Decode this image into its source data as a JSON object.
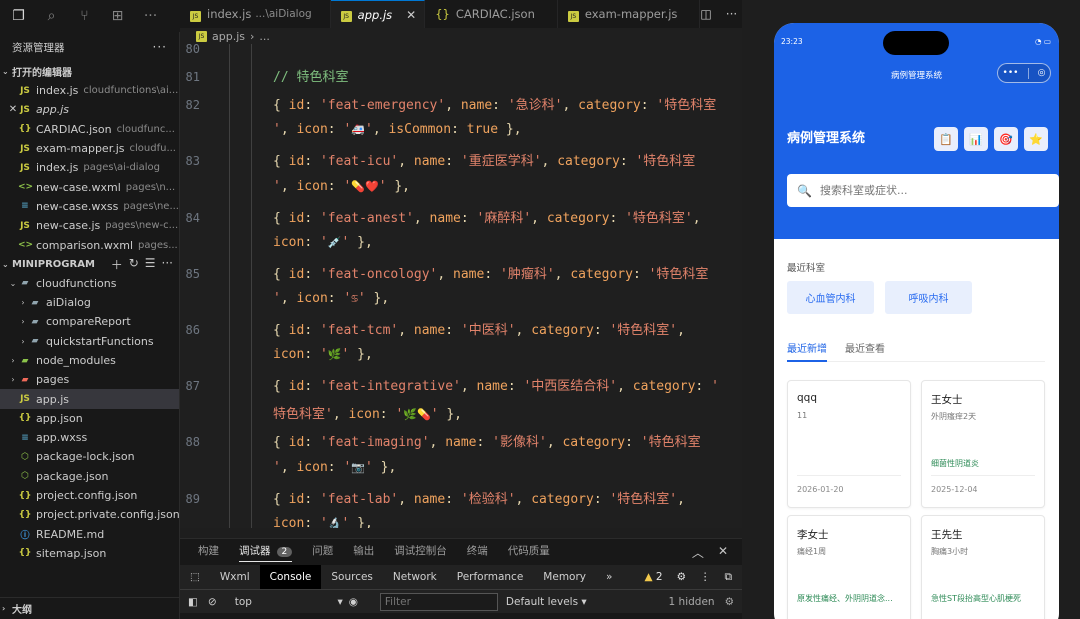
{
  "sidebar": {
    "title": "资源管理器",
    "more": "···",
    "open_editors_label": "打开的编辑器",
    "open_editors": [
      {
        "name": "index.js",
        "desc": "cloudfunctions\\ai...",
        "icon": "JS",
        "italic": false,
        "close": ""
      },
      {
        "name": "app.js",
        "desc": "",
        "icon": "JS",
        "italic": true,
        "close": "✕"
      },
      {
        "name": "CARDIAC.json",
        "desc": "cloudfunc...",
        "icon": "{}",
        "italic": false,
        "close": ""
      },
      {
        "name": "exam-mapper.js",
        "desc": "cloudfu...",
        "icon": "JS",
        "italic": false,
        "close": ""
      },
      {
        "name": "index.js",
        "desc": "pages\\ai-dialog",
        "icon": "JS",
        "italic": false,
        "close": ""
      },
      {
        "name": "new-case.wxml",
        "desc": "pages\\n...",
        "icon": "<>",
        "italic": false,
        "close": ""
      },
      {
        "name": "new-case.wxss",
        "desc": "pages\\ne...",
        "icon": "≡",
        "italic": false,
        "close": ""
      },
      {
        "name": "new-case.js",
        "desc": "pages\\new-c...",
        "icon": "JS",
        "italic": false,
        "close": ""
      },
      {
        "name": "comparison.wxml",
        "desc": "pages...",
        "icon": "<>",
        "italic": false,
        "close": ""
      }
    ],
    "project_label": "MINIPROGRAM",
    "tree": [
      {
        "name": "cloudfunctions",
        "arrow": "⌄",
        "indent": 1,
        "icon": "folder-open"
      },
      {
        "name": "aiDialog",
        "arrow": "›",
        "indent": 2,
        "icon": "folder"
      },
      {
        "name": "compareReport",
        "arrow": "›",
        "indent": 2,
        "icon": "folder"
      },
      {
        "name": "quickstartFunctions",
        "arrow": "›",
        "indent": 2,
        "icon": "folder"
      },
      {
        "name": "node_modules",
        "arrow": "›",
        "indent": 1,
        "icon": "folder-node"
      },
      {
        "name": "pages",
        "arrow": "›",
        "indent": 1,
        "icon": "folder-pages"
      },
      {
        "name": "app.js",
        "arrow": "",
        "indent": 1,
        "icon": "js",
        "selected": true
      },
      {
        "name": "app.json",
        "arrow": "",
        "indent": 1,
        "icon": "json"
      },
      {
        "name": "app.wxss",
        "arrow": "",
        "indent": 1,
        "icon": "wxss"
      },
      {
        "name": "package-lock.json",
        "arrow": "",
        "indent": 1,
        "icon": "package"
      },
      {
        "name": "package.json",
        "arrow": "",
        "indent": 1,
        "icon": "package"
      },
      {
        "name": "project.config.json",
        "arrow": "",
        "indent": 1,
        "icon": "json"
      },
      {
        "name": "project.private.config.json",
        "arrow": "",
        "indent": 1,
        "icon": "json"
      },
      {
        "name": "README.md",
        "arrow": "",
        "indent": 1,
        "icon": "info"
      },
      {
        "name": "sitemap.json",
        "arrow": "",
        "indent": 1,
        "icon": "json"
      }
    ],
    "outline_label": "大纲"
  },
  "tabs": [
    {
      "name": "index.js",
      "desc": "...\\aiDialog",
      "active": false,
      "close": ""
    },
    {
      "name": "app.js",
      "desc": "",
      "active": true,
      "close": "✕"
    },
    {
      "name": "CARDIAC.json",
      "desc": "",
      "active": false,
      "close": ""
    },
    {
      "name": "exam-mapper.js",
      "desc": "",
      "active": false,
      "close": ""
    }
  ],
  "breadcrumb": {
    "file": "app.js",
    "more": "..."
  },
  "code": {
    "lines": [
      {
        "num": "80",
        "html": ""
      },
      {
        "num": "81",
        "html": "<span class='c'>// 特色科室</span>"
      },
      {
        "num": "82",
        "html": "<span class='p'>{ </span><span class='k'>id</span><span class='p'>: </span><span class='s'>'feat-emergency'</span><span class='p'>, </span><span class='k'>name</span><span class='p'>: </span><span class='s'>'急诊科'</span><span class='p'>, </span><span class='k'>category</span><span class='p'>: </span><span class='s'>'特色科室</span>"
      },
      {
        "num": "",
        "html": "<span class='s'>'</span><span class='p'>, </span><span class='k'>icon</span><span class='p'>: </span><span class='s'>'<span class=\"e\">🚑</span>'</span><span class='p'>, </span><span class='k'>isCommon</span><span class='p'>: </span><span class='b'>true</span><span class='p'> },</span>"
      },
      {
        "num": "83",
        "html": "<span class='p'>{ </span><span class='k'>id</span><span class='p'>: </span><span class='s'>'feat-icu'</span><span class='p'>, </span><span class='k'>name</span><span class='p'>: </span><span class='s'>'重症医学科'</span><span class='p'>, </span><span class='k'>category</span><span class='p'>: </span><span class='s'>'特色科室</span>"
      },
      {
        "num": "",
        "html": "<span class='s'>'</span><span class='p'>, </span><span class='k'>icon</span><span class='p'>: </span><span class='s'>'<span class=\"e\">💊❤️</span>'</span><span class='p'> },</span>"
      },
      {
        "num": "84",
        "html": "<span class='p'>{ </span><span class='k'>id</span><span class='p'>: </span><span class='s'>'feat-anest'</span><span class='p'>, </span><span class='k'>name</span><span class='p'>: </span><span class='s'>'麻醉科'</span><span class='p'>, </span><span class='k'>category</span><span class='p'>: </span><span class='s'>'特色科室'</span><span class='p'>,</span>"
      },
      {
        "num": "",
        "html": "<span class='k'>icon</span><span class='p'>: </span><span class='s'>'<span class=\"e\">💉</span>'</span><span class='p'> },</span>"
      },
      {
        "num": "85",
        "html": "<span class='p'>{ </span><span class='k'>id</span><span class='p'>: </span><span class='s'>'feat-oncology'</span><span class='p'>, </span><span class='k'>name</span><span class='p'>: </span><span class='s'>'肿瘤科'</span><span class='p'>, </span><span class='k'>category</span><span class='p'>: </span><span class='s'>'特色科室</span>"
      },
      {
        "num": "",
        "html": "<span class='s'>'</span><span class='p'>, </span><span class='k'>icon</span><span class='p'>: </span><span class='s'>'<span class=\"e\">♋</span>'</span><span class='p'> },</span>"
      },
      {
        "num": "86",
        "html": "<span class='p'>{ </span><span class='k'>id</span><span class='p'>: </span><span class='s'>'feat-tcm'</span><span class='p'>, </span><span class='k'>name</span><span class='p'>: </span><span class='s'>'中医科'</span><span class='p'>, </span><span class='k'>category</span><span class='p'>: </span><span class='s'>'特色科室'</span><span class='p'>,</span>"
      },
      {
        "num": "",
        "html": "<span class='k'>icon</span><span class='p'>: </span><span class='s'>'<span class=\"e\">🌿</span>'</span><span class='p'> },</span>"
      },
      {
        "num": "87",
        "html": "<span class='p'>{ </span><span class='k'>id</span><span class='p'>: </span><span class='s'>'feat-integrative'</span><span class='p'>, </span><span class='k'>name</span><span class='p'>: </span><span class='s'>'中西医结合科'</span><span class='p'>, </span><span class='k'>category</span><span class='p'>: </span><span class='s'>'</span>"
      },
      {
        "num": "",
        "html": "<span class='s'>特色科室'</span><span class='p'>, </span><span class='k'>icon</span><span class='p'>: </span><span class='s'>'<span class=\"e\">🌿💊</span>'</span><span class='p'> },</span>"
      },
      {
        "num": "88",
        "html": "<span class='p'>{ </span><span class='k'>id</span><span class='p'>: </span><span class='s'>'feat-imaging'</span><span class='p'>, </span><span class='k'>name</span><span class='p'>: </span><span class='s'>'影像科'</span><span class='p'>, </span><span class='k'>category</span><span class='p'>: </span><span class='s'>'特色科室</span>"
      },
      {
        "num": "",
        "html": "<span class='s'>'</span><span class='p'>, </span><span class='k'>icon</span><span class='p'>: </span><span class='s'>'<span class=\"e\">📷</span>'</span><span class='p'> },</span>"
      },
      {
        "num": "89",
        "html": "<span class='p'>{ </span><span class='k'>id</span><span class='p'>: </span><span class='s'>'feat-lab'</span><span class='p'>, </span><span class='k'>name</span><span class='p'>: </span><span class='s'>'检验科'</span><span class='p'>, </span><span class='k'>category</span><span class='p'>: </span><span class='s'>'特色科室'</span><span class='p'>,</span>"
      },
      {
        "num": "",
        "html": "<span class='k'>icon</span><span class='p'>: </span><span class='s'>'<span class=\"e\">🔬</span>'</span><span class='p'> },</span>"
      }
    ]
  },
  "panel": {
    "tabs": [
      "构建",
      "调试器",
      "问题",
      "输出",
      "调试控制台",
      "终端",
      "代码质量"
    ],
    "active": "调试器",
    "badge": "2",
    "devtools": [
      "Wxml",
      "Console",
      "Sources",
      "Network",
      "Performance",
      "Memory"
    ],
    "devtools_active": "Console",
    "more": "»",
    "warn_count": "2",
    "context": "top",
    "filter_placeholder": "Filter",
    "levels": "Default levels",
    "hidden": "1 hidden"
  },
  "phone": {
    "time": "23:23",
    "nav_title": "病例管理系统",
    "app_title": "病例管理系统",
    "quick_icons": [
      "📋",
      "📊",
      "🎯",
      "⭐"
    ],
    "search_placeholder": "搜索科室或症状...",
    "recent_label": "最近科室",
    "recent_chips": [
      "心血管内科",
      "呼吸内科"
    ],
    "segments": [
      "最近新增",
      "最近查看"
    ],
    "cards": [
      {
        "name": "qqq",
        "sub": "11",
        "diag": "",
        "date": "2026-01-20"
      },
      {
        "name": "王女士",
        "sub": "外阴瘙痒2天",
        "diag": "细菌性阴道炎",
        "date": "2025-12-04"
      },
      {
        "name": "李女士",
        "sub": "痛经1周",
        "diag": "原发性痛经、外阴阴道念...",
        "date": ""
      },
      {
        "name": "王先生",
        "sub": "胸痛3小时",
        "diag": "急性ST段抬高型心肌梗死",
        "date": ""
      }
    ]
  },
  "colors": {
    "accent": "#1c62e6",
    "chip_text": "#2a6cf0",
    "diag_green": "#2e8b57"
  }
}
